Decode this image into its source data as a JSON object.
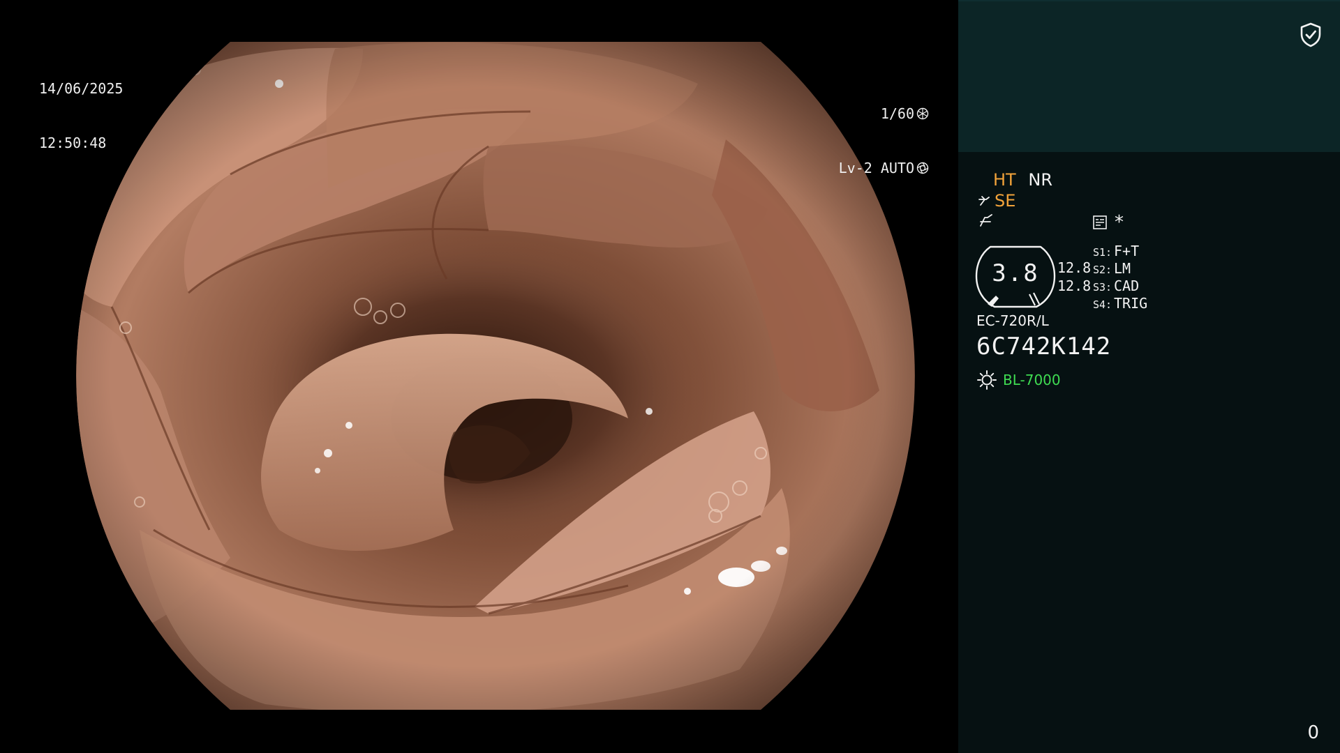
{
  "osd": {
    "date": "14/06/2025",
    "time": "12:50:48",
    "shutter": "1/60",
    "shutter_icon": "shutter-icon",
    "iris_mode": "Lv-2 AUTO",
    "iris_icon": "iris-icon"
  },
  "panel": {
    "shield_icon": "shield-check-icon",
    "mode_ht": "HT",
    "mode_nr": "NR",
    "mode_se": "SE",
    "se_icon": "scope-tip-icon",
    "enhance_icon": "enhance-icon",
    "record_icon": "record-icon",
    "asterisk": "*",
    "gauge_value": "3.8",
    "gauge_sub_1": "12.8",
    "gauge_sub_2": "12.8",
    "switches": [
      {
        "key": "S1:",
        "value": "F+T"
      },
      {
        "key": "S2:",
        "value": "LM"
      },
      {
        "key": "S3:",
        "value": "CAD"
      },
      {
        "key": "S4:",
        "value": "TRIG"
      }
    ],
    "scope_model": "EC-720R/L",
    "scope_serial": "6C742K142",
    "light_icon": "lamp-icon",
    "light_source": "BL-7000",
    "counter": "0"
  },
  "colors": {
    "panel_bg": "#061112",
    "panel_top_bg": "#0c2526",
    "accent_orange": "#f2a33a",
    "accent_green": "#3fdc52",
    "text_white": "#f2f2f2"
  }
}
